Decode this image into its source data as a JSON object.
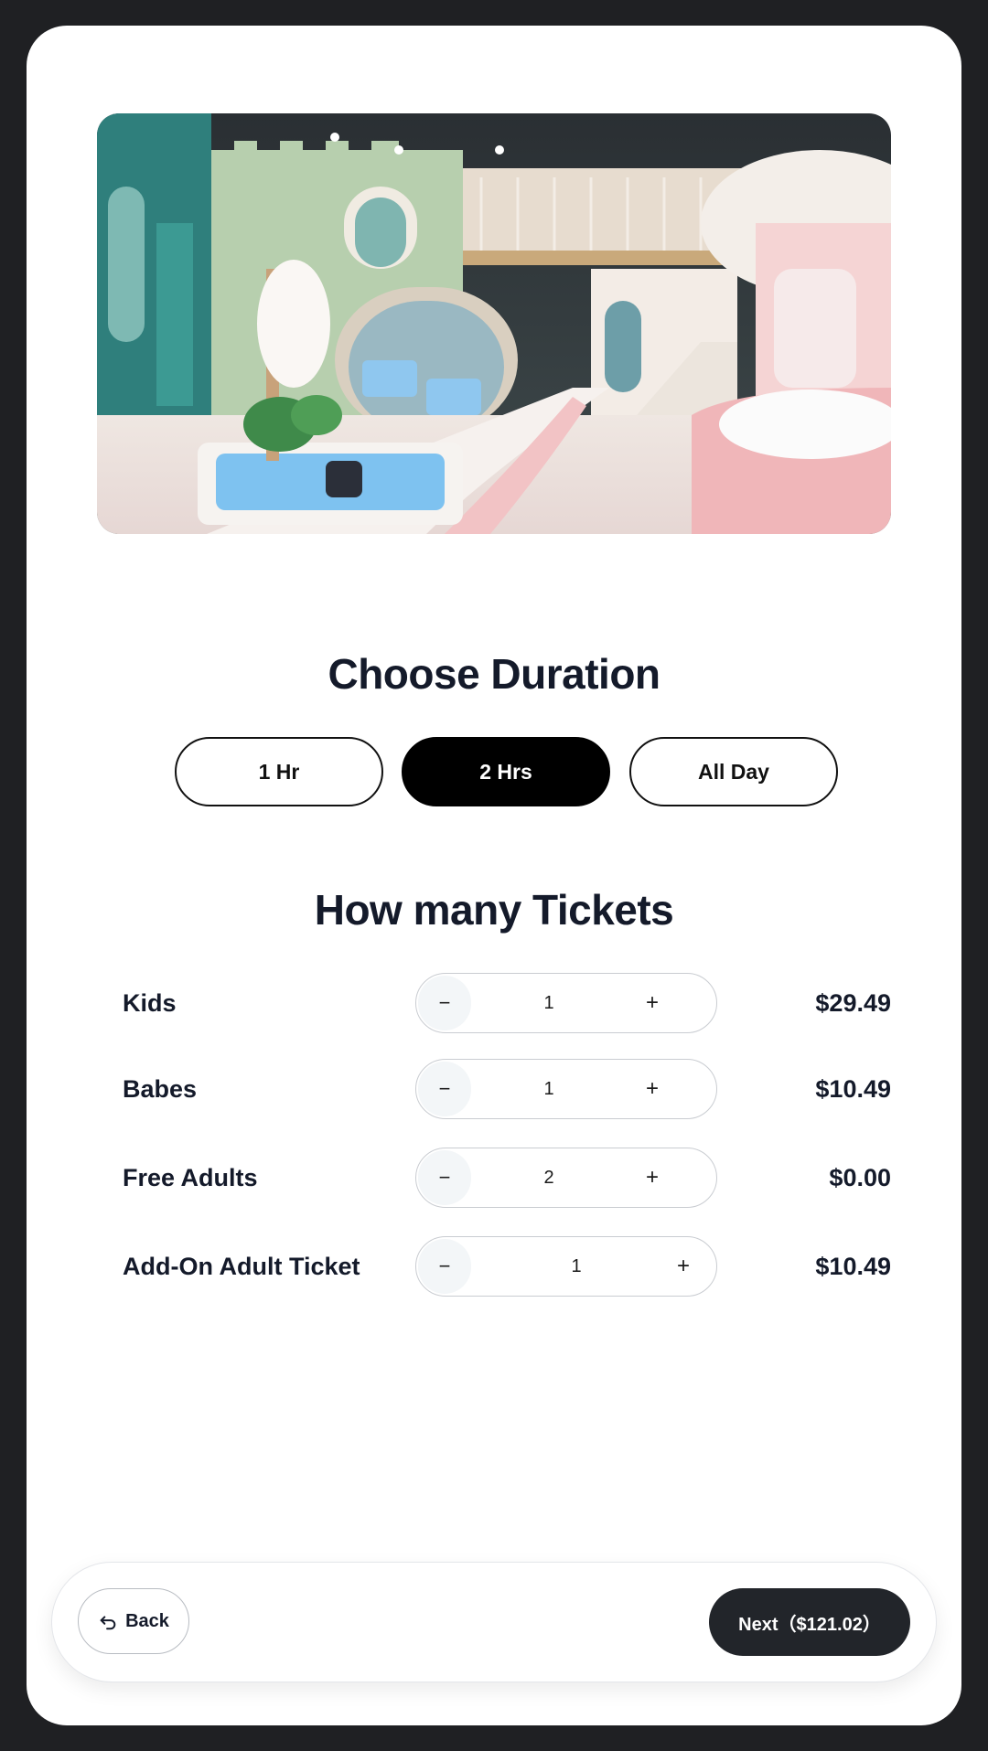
{
  "hero": {
    "image_description": ""
  },
  "duration": {
    "title": "Choose Duration",
    "options": [
      {
        "label": "1 Hr",
        "selected": false
      },
      {
        "label": "2 Hrs",
        "selected": true
      },
      {
        "label": "All Day",
        "selected": false
      }
    ]
  },
  "tickets": {
    "title": "How many Tickets",
    "rows": [
      {
        "label": "Kids",
        "quantity": "1",
        "price": "$29.49",
        "minus": "−",
        "plus": "+"
      },
      {
        "label": "Babes",
        "quantity": "1",
        "price": "$10.49",
        "minus": "−",
        "plus": "+"
      },
      {
        "label": "Free Adults",
        "quantity": "2",
        "price": "$0.00",
        "minus": "−",
        "plus": "+"
      },
      {
        "label": "Add-On Adult Ticket",
        "quantity": "1",
        "price": "$10.49",
        "minus": "−",
        "plus": "+"
      }
    ]
  },
  "footer": {
    "back_label": "Back",
    "back_icon": "back-arrow-icon",
    "next_label": "Next（$121.02）"
  },
  "colors": {
    "frame": "#1f2023",
    "text": "#141a2a",
    "selected_pill": "#000000",
    "next_button": "#22252a"
  }
}
